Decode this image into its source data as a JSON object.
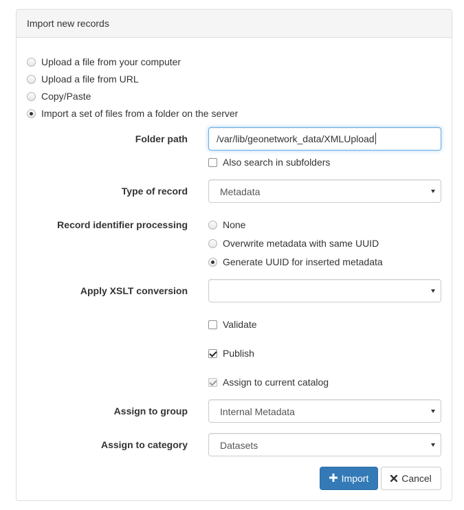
{
  "panel": {
    "title": "Import new records"
  },
  "import_mode": {
    "options": [
      {
        "label": "Upload a file from your computer",
        "selected": false
      },
      {
        "label": "Upload a file from URL",
        "selected": false
      },
      {
        "label": "Copy/Paste",
        "selected": false
      },
      {
        "label": "Import a set of files from a folder on the server",
        "selected": true
      }
    ]
  },
  "folder_path": {
    "label": "Folder path",
    "value": "/var/lib/geonetwork_data/XMLUpload",
    "subfolders_label": "Also search in subfolders",
    "subfolders_checked": false
  },
  "record_type": {
    "label": "Type of record",
    "value": "Metadata"
  },
  "identifier_processing": {
    "label": "Record identifier processing",
    "options": [
      {
        "label": "None",
        "selected": false
      },
      {
        "label": "Overwrite metadata with same UUID",
        "selected": false
      },
      {
        "label": "Generate UUID for inserted metadata",
        "selected": true
      }
    ]
  },
  "xslt": {
    "label": "Apply XSLT conversion",
    "value": ""
  },
  "validate": {
    "label": "Validate",
    "checked": false
  },
  "publish": {
    "label": "Publish",
    "checked": true
  },
  "assign_catalog": {
    "label": "Assign to current catalog",
    "checked": true,
    "disabled": true
  },
  "group": {
    "label": "Assign to group",
    "value": "Internal Metadata"
  },
  "category": {
    "label": "Assign to category",
    "value": "Datasets"
  },
  "actions": {
    "import_label": "Import",
    "import_icon": "plus-icon",
    "cancel_label": "Cancel",
    "cancel_icon": "close-icon",
    "primary_color": "#337ab7"
  }
}
